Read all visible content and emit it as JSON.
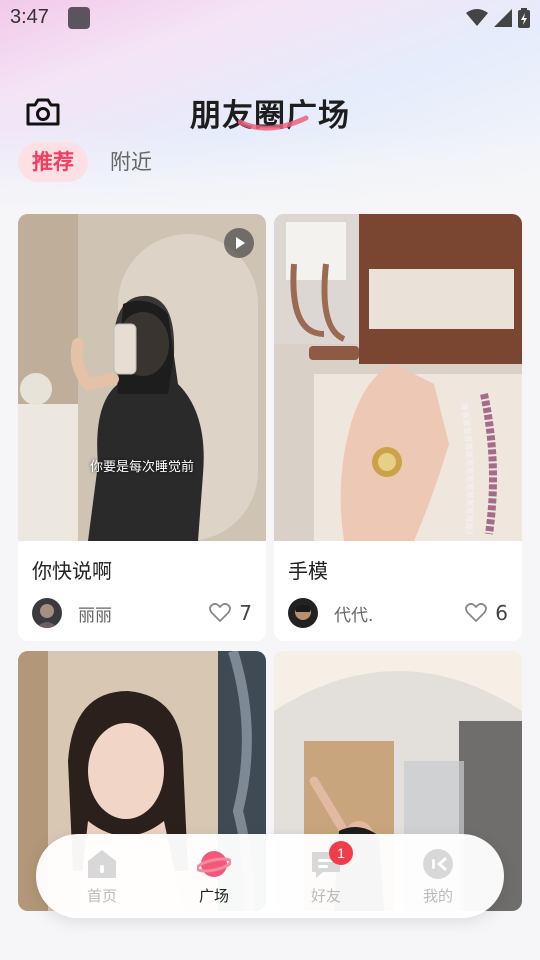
{
  "status_bar": {
    "time": "3:47"
  },
  "header": {
    "title": "朋友圈广场"
  },
  "tabs": [
    {
      "label": "推荐",
      "active": true
    },
    {
      "label": "附近",
      "active": false
    }
  ],
  "feed": [
    {
      "title": "你快说啊",
      "author": "丽丽",
      "likes": "7",
      "has_video": true,
      "subtitle": "你要是每次睡觉前"
    },
    {
      "title": "手模",
      "author": "代代.",
      "likes": "6",
      "has_video": false
    },
    {
      "title": "",
      "author": "",
      "likes": ""
    },
    {
      "title": "",
      "author": "",
      "likes": ""
    }
  ],
  "bottom_nav": [
    {
      "label": "首页",
      "icon": "home-icon",
      "active": false
    },
    {
      "label": "广场",
      "icon": "planet-icon",
      "active": true
    },
    {
      "label": "好友",
      "icon": "chat-icon",
      "active": false,
      "badge": "1"
    },
    {
      "label": "我的",
      "icon": "profile-icon",
      "active": false
    }
  ],
  "colors": {
    "accent": "#f23d5c",
    "tab_bg": "#fde0e6",
    "badge": "#f03d4a"
  }
}
